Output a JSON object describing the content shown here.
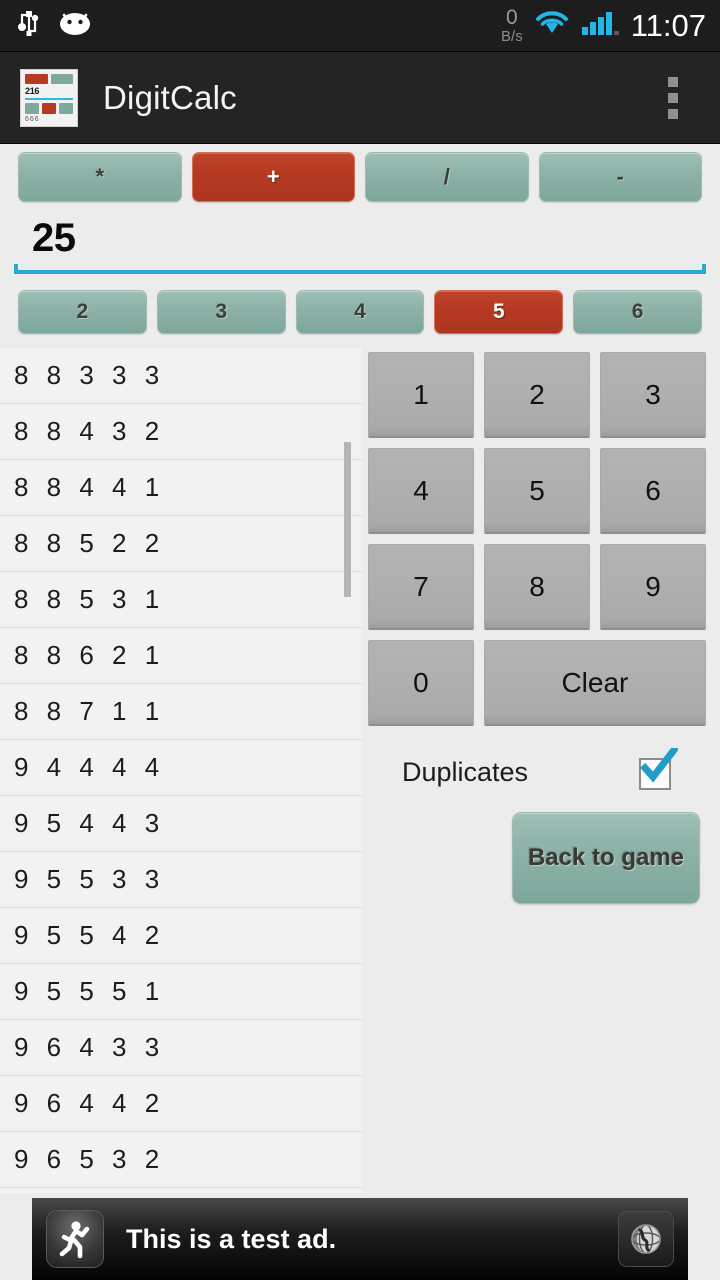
{
  "status_bar": {
    "usb_icon": "usb-icon",
    "android_head_icon": "android-head-icon",
    "net_speed_value": "0",
    "net_speed_unit": "B/s",
    "wifi_icon": "wifi-icon",
    "signal_icon": "signal-bars-icon",
    "clock": "11:07"
  },
  "action_bar": {
    "app_icon": "app-logo-icon",
    "app_icon_detail": {
      "number": "216",
      "footer": "666"
    },
    "title": "DigitCalc",
    "overflow_icon": "overflow-menu-icon"
  },
  "operators": {
    "selected": "+",
    "items": [
      {
        "label": "*",
        "selected": false
      },
      {
        "label": "+",
        "selected": true
      },
      {
        "label": "/",
        "selected": false
      },
      {
        "label": "-",
        "selected": false
      }
    ]
  },
  "display": {
    "value": "25",
    "placeholder": "",
    "underline_color": "#2aa9d6"
  },
  "digit_count": {
    "selected": "5",
    "items": [
      {
        "label": "2",
        "selected": false
      },
      {
        "label": "3",
        "selected": false
      },
      {
        "label": "4",
        "selected": false
      },
      {
        "label": "5",
        "selected": true
      },
      {
        "label": "6",
        "selected": false
      }
    ]
  },
  "results_list": [
    "8 8 3 3 3",
    "8 8 4 3 2",
    "8 8 4 4 1",
    "8 8 5 2 2",
    "8 8 5 3 1",
    "8 8 6 2 1",
    "8 8 7 1 1",
    "9 4 4 4 4",
    "9 5 4 4 3",
    "9 5 5 3 3",
    "9 5 5 4 2",
    "9 5 5 5 1",
    "9 6 4 3 3",
    "9 6 4 4 2",
    "9 6 5 3 2"
  ],
  "keypad": {
    "rows": [
      [
        {
          "label": "1",
          "wide": false
        },
        {
          "label": "2",
          "wide": false
        },
        {
          "label": "3",
          "wide": false
        }
      ],
      [
        {
          "label": "4",
          "wide": false
        },
        {
          "label": "5",
          "wide": false
        },
        {
          "label": "6",
          "wide": false
        }
      ],
      [
        {
          "label": "7",
          "wide": false
        },
        {
          "label": "8",
          "wide": false
        },
        {
          "label": "9",
          "wide": false
        }
      ],
      [
        {
          "label": "0",
          "wide": false
        },
        {
          "label": "Clear",
          "wide": true
        }
      ]
    ]
  },
  "duplicates": {
    "label": "Duplicates",
    "checked": true,
    "checkbox_icon": "checkbox-checked-icon"
  },
  "back_button": {
    "label": "Back to game"
  },
  "ad": {
    "icon": "running-person-icon",
    "text": "This is a test ad.",
    "action_icon": "globe-icon"
  },
  "colors": {
    "accent_teal": "#8cb1a7",
    "accent_red": "#b63a23",
    "underline_blue": "#2aa9d6",
    "checkbox_blue": "#2196c4",
    "keypad_gray": "#ababab",
    "page_bg": "#ececec",
    "action_bar_bg": "#242424"
  }
}
